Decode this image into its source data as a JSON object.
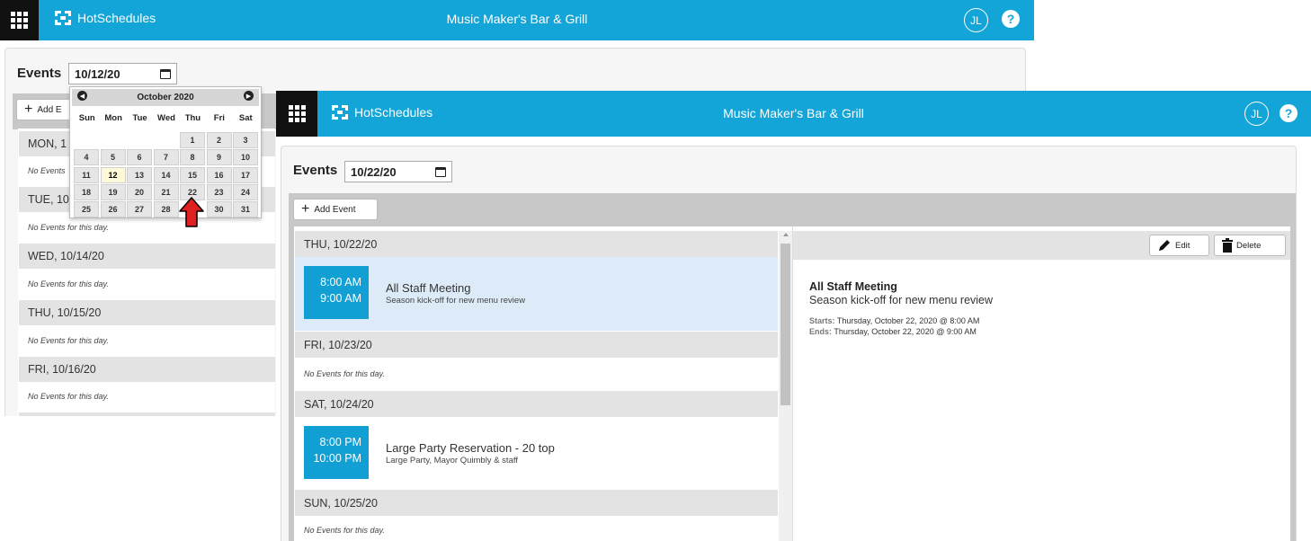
{
  "app": {
    "logo_text": "HotSchedules",
    "venue": "Music Maker's Bar & Grill",
    "user_initials": "JL",
    "help_symbol": "?"
  },
  "back_window": {
    "events_label": "Events",
    "date_value": "10/12/20",
    "add_event_label": "Add E",
    "days": [
      {
        "label": "MON, 1",
        "empty_text": "No Events"
      },
      {
        "label": "TUE, 10",
        "empty_text": "No Events for this day."
      },
      {
        "label": "WED, 10/14/20",
        "empty_text": "No Events for this day."
      },
      {
        "label": "THU, 10/15/20",
        "empty_text": "No Events for this day."
      },
      {
        "label": "FRI, 10/16/20",
        "empty_text": "No Events for this day."
      }
    ],
    "date_picker": {
      "month_label": "October 2020",
      "prev_icon": "chevron-left-icon",
      "next_icon": "chevron-right-icon",
      "weekdays": [
        "Sun",
        "Mon",
        "Tue",
        "Wed",
        "Thu",
        "Fri",
        "Sat"
      ],
      "weeks": [
        [
          "",
          "",
          "",
          "",
          "1",
          "2",
          "3"
        ],
        [
          "4",
          "5",
          "6",
          "7",
          "8",
          "9",
          "10"
        ],
        [
          "11",
          "12",
          "13",
          "14",
          "15",
          "16",
          "17"
        ],
        [
          "18",
          "19",
          "20",
          "21",
          "22",
          "23",
          "24"
        ],
        [
          "25",
          "26",
          "27",
          "28",
          "",
          "30",
          "31"
        ]
      ],
      "selected_day": "12",
      "highlighted_day": "22"
    }
  },
  "front_window": {
    "events_label": "Events",
    "date_value": "10/22/20",
    "add_event_label": "Add Event",
    "days": [
      {
        "label": "THU, 10/22/20"
      },
      {
        "label": "FRI, 10/23/20",
        "empty_text": "No Events for this day."
      },
      {
        "label": "SAT, 10/24/20"
      },
      {
        "label": "SUN, 10/25/20",
        "empty_text": "No Events for this day."
      }
    ],
    "events": [
      {
        "start": "8:00 AM",
        "end": "9:00 AM",
        "title": "All Staff Meeting",
        "subtitle": "Season kick-off for new menu review"
      },
      {
        "start": "8:00 PM",
        "end": "10:00 PM",
        "title": "Large Party Reservation - 20 top",
        "subtitle": "Large Party, Mayor Quimbly & staff"
      }
    ],
    "detail": {
      "edit_label": "Edit",
      "delete_label": "Delete",
      "title": "All Staff Meeting",
      "subtitle": "Season kick-off for new menu review",
      "starts_label": "Starts:",
      "starts_value": "Thursday, October 22, 2020 @ 8:00 AM",
      "ends_label": "Ends:",
      "ends_value": "Thursday, October 22, 2020 @ 9:00 AM"
    }
  },
  "colors": {
    "brand_blue": "#13a4d8",
    "highlight_row": "#dcebf7",
    "arrow_red": "#e02020"
  }
}
